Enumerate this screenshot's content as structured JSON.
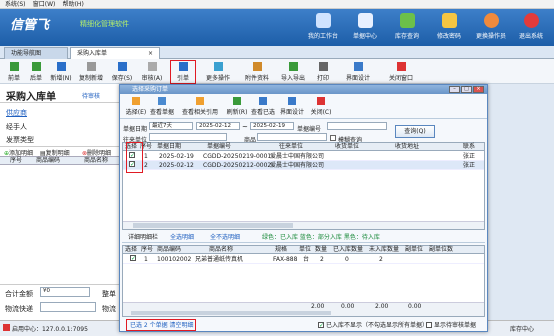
{
  "menubar": {
    "items": [
      "系统(S)",
      "窗口(W)",
      "帮助(H)"
    ]
  },
  "banner": {
    "logo": "信管飞",
    "subtitle": "精细化管理软件",
    "buttons": [
      "我的工作台",
      "单据中心",
      "库存查询",
      "修改密码",
      "更换操作员",
      "退出系统"
    ]
  },
  "tabs": {
    "home": "功能导航图",
    "current": "采购入库单",
    "close": "×"
  },
  "toolbar": [
    "前单",
    "后单",
    "新增(N)",
    "复制新增",
    "保存(S)",
    "审核(A)",
    "引单",
    "更多操作",
    "附件资料",
    "导入导出",
    "打印",
    "界面设计",
    "关闭窗口"
  ],
  "form": {
    "title": "采购入库单",
    "status": "待审核",
    "fields": [
      "供应商",
      "经手人",
      "发票类型"
    ],
    "actions": [
      "添加明细",
      "复制明细",
      "删除明细"
    ],
    "grid_headers": [
      "序号",
      "商品编码",
      "商品名称"
    ],
    "total_label": "合计金额",
    "total_value": "¥0",
    "logistics_label": "物流快递",
    "extra_label": "整单",
    "extra2": "物流"
  },
  "dialog": {
    "title": "选择采购订单",
    "toolbar": [
      "选择(E)",
      "查看单据",
      "查看相关引用",
      "刷新(R)",
      "查看已选",
      "界面设计",
      "关闭(C)"
    ],
    "filter": {
      "date_label": "单据日期",
      "period": "最近7天",
      "date_from": "2025-02-12",
      "to": "~",
      "date_to": "2025-02-19",
      "doc_no_label": "单据编号",
      "party_label": "往来单位",
      "product_label": "商品",
      "fuzzy_label": "模糊查询",
      "query_button": "查询(Q)"
    },
    "top_headers": [
      "选择",
      "序号",
      "单据日期",
      "单据编号",
      "往来单位",
      "收货单位",
      "收货地址",
      "联系"
    ],
    "top_rows": [
      {
        "seq": "1",
        "date": "2025-02-19",
        "no": "CGDD-20250219-0001",
        "party": "爱晨士中国有限公司",
        "contact": "张正"
      },
      {
        "seq": "2",
        "date": "2025-02-12",
        "no": "CGDD-20250212-0002",
        "party": "爱晨士中国有限公司",
        "contact": "张正"
      }
    ],
    "detail_bar": {
      "label": "详细明细栏",
      "select_all": "全选明细",
      "deselect_all": "全不选明细",
      "legend": "绿色：已入库 蓝色：部分入库 黑色：待入库"
    },
    "bottom_headers": [
      "选择",
      "序号",
      "商品编码",
      "商品名称",
      "规格",
      "单位",
      "数量",
      "已入库数量",
      "未入库数量",
      "副单位",
      "副单位数"
    ],
    "bottom_row": {
      "seq": "1",
      "code": "100102002",
      "name": "兄弟普通纸传真机",
      "spec": "FAX-888",
      "unit": "台",
      "qty": "2",
      "done": "0",
      "todo": "2"
    },
    "totals": [
      "2.00",
      "0.00",
      "2.00",
      "0.00"
    ],
    "footer": {
      "selected": "已选 2 个单据 清空明细",
      "opt1": "已入库不显示（不勾选显示所有单据）",
      "opt2": "显示待审核单据"
    }
  },
  "status": {
    "left": "启用中心：127.0.0.1:7095",
    "right": "库存中心"
  }
}
